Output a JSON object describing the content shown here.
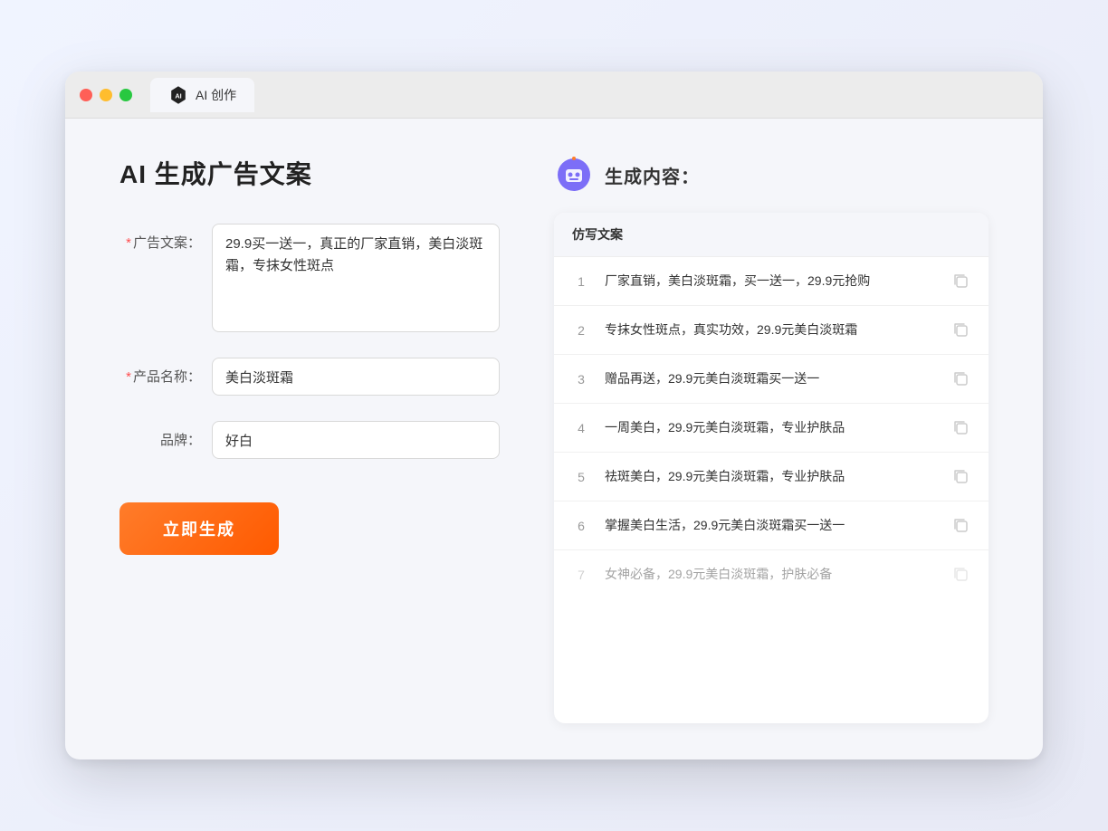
{
  "browser": {
    "tab_label": "AI 创作",
    "controls": {
      "close": "close",
      "minimize": "minimize",
      "maximize": "maximize"
    }
  },
  "page": {
    "title": "AI 生成广告文案",
    "result_title": "生成内容：",
    "table_header": "仿写文案",
    "generate_button": "立即生成"
  },
  "form": {
    "ad_copy_label": "广告文案：",
    "ad_copy_required": "*",
    "ad_copy_value": "29.9买一送一，真正的厂家直销，美白淡斑霜，专抹女性斑点",
    "product_name_label": "产品名称：",
    "product_name_required": "*",
    "product_name_value": "美白淡斑霜",
    "brand_label": "品牌：",
    "brand_value": "好白"
  },
  "results": [
    {
      "num": "1",
      "text": "厂家直销，美白淡斑霜，买一送一，29.9元抢购",
      "dim": false
    },
    {
      "num": "2",
      "text": "专抹女性斑点，真实功效，29.9元美白淡斑霜",
      "dim": false
    },
    {
      "num": "3",
      "text": "赠品再送，29.9元美白淡斑霜买一送一",
      "dim": false
    },
    {
      "num": "4",
      "text": "一周美白，29.9元美白淡斑霜，专业护肤品",
      "dim": false
    },
    {
      "num": "5",
      "text": "祛斑美白，29.9元美白淡斑霜，专业护肤品",
      "dim": false
    },
    {
      "num": "6",
      "text": "掌握美白生活，29.9元美白淡斑霜买一送一",
      "dim": false
    },
    {
      "num": "7",
      "text": "女神必备，29.9元美白淡斑霜，护肤必备",
      "dim": true
    }
  ],
  "colors": {
    "accent_orange": "#ff6b1a",
    "accent_blue": "#667eea",
    "required_red": "#ff4d4f"
  }
}
